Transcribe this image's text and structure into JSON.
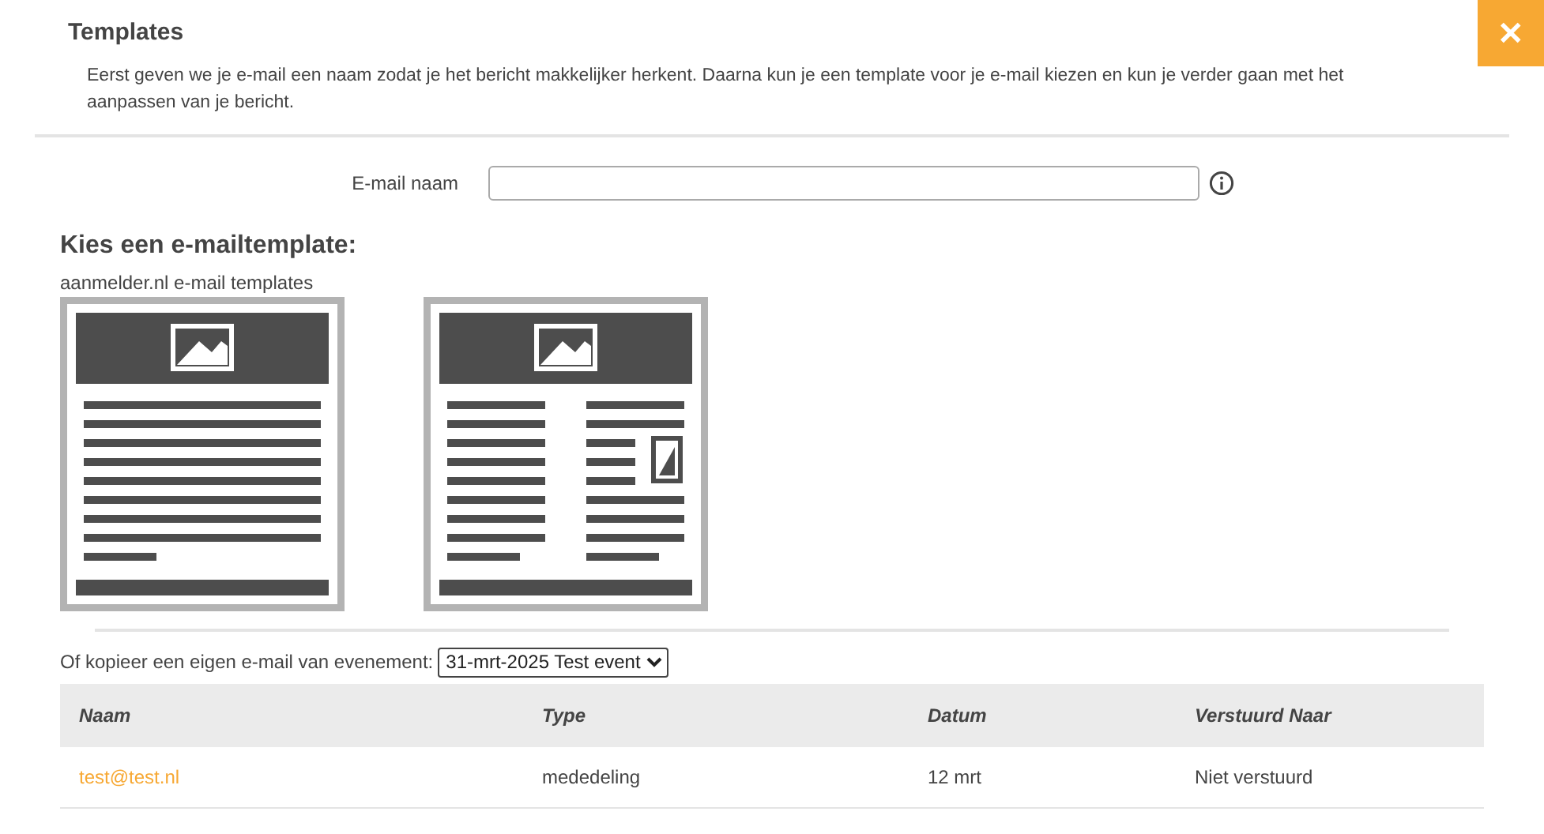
{
  "header": {
    "title": "Templates",
    "close": "✕",
    "description": "Eerst geven we je e-mail een naam zodat je het bericht makkelijker herkent. Daarna kun je een template voor je e-mail kiezen en kun je verder gaan met het aanpassen van je bericht."
  },
  "name_field": {
    "label": "E-mail naam"
  },
  "templates": {
    "heading": "Kies een e-mailtemplate:",
    "source": "aanmelder.nl e-mail templates",
    "items": [
      {
        "kind": "single-column"
      },
      {
        "kind": "two-column"
      }
    ]
  },
  "copy": {
    "label": "Of kopieer een eigen e-mail van evenement:",
    "event": "31-mrt-2025 Test event"
  },
  "table": {
    "columns": [
      "Naam",
      "Type",
      "Datum",
      "Verstuurd Naar"
    ],
    "rows": [
      {
        "cells": [
          "test@test.nl",
          "mededeling",
          "12 mrt",
          "Niet verstuurd"
        ]
      }
    ]
  }
}
